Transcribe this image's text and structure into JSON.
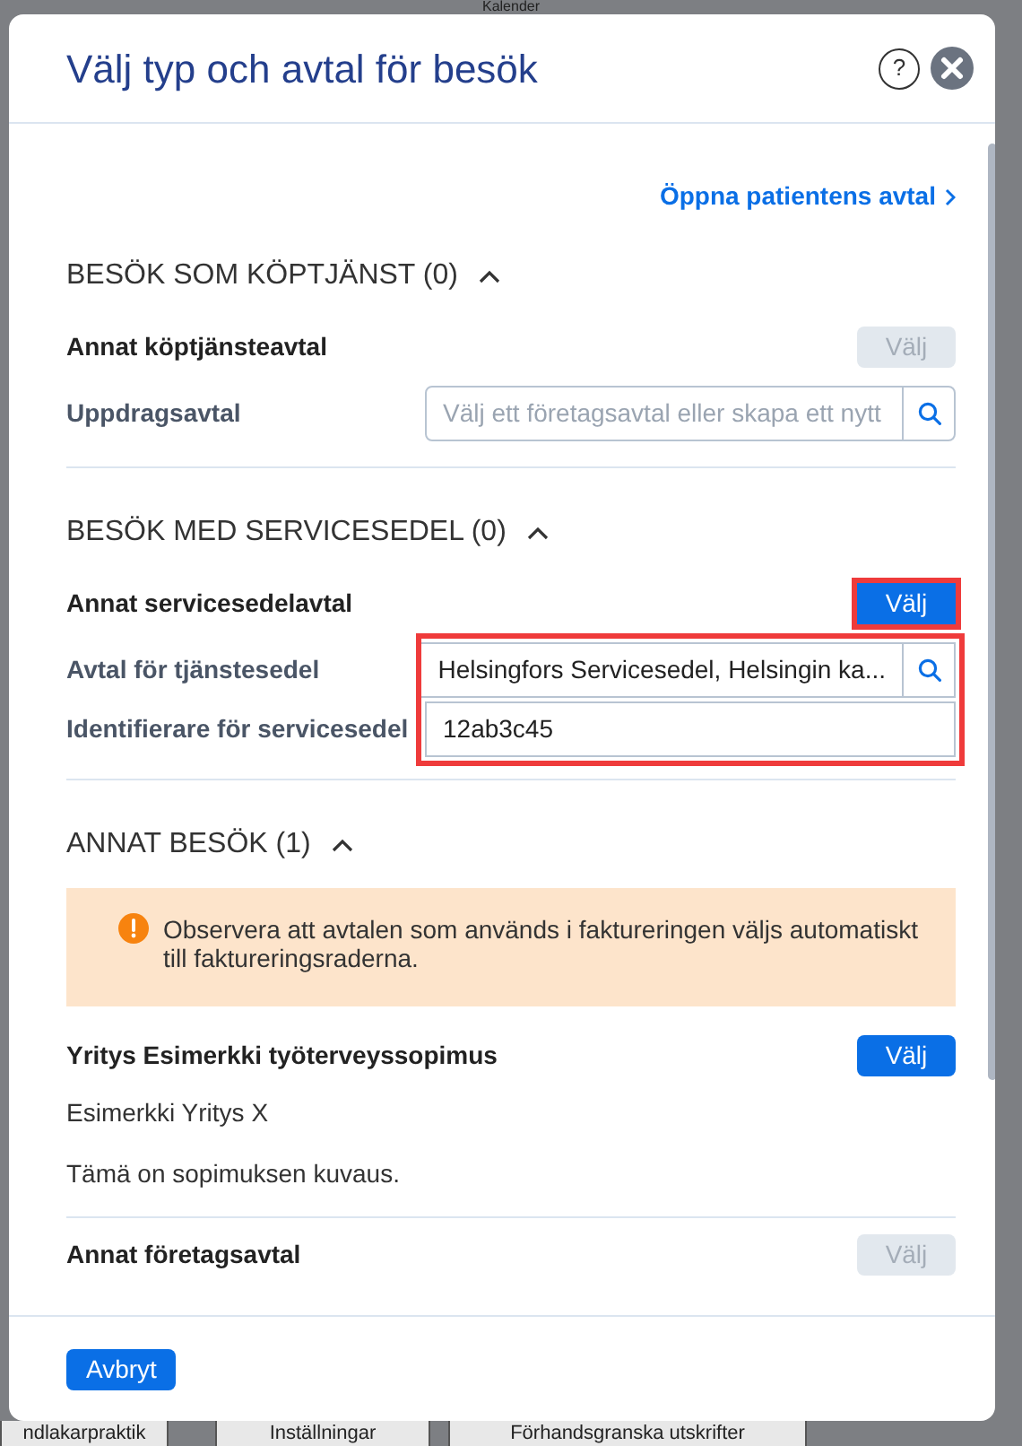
{
  "background": {
    "header_title": "Kalender",
    "bottom_tabs": [
      "ndlakarpraktik",
      "Inställningar",
      "Förhandsgranska utskrifter"
    ]
  },
  "dialog": {
    "title": "Välj typ och avtal för besök",
    "help_label": "?",
    "link": "Öppna patientens avtal",
    "sections": [
      {
        "title": "BESÖK SOM KÖPTJÄNST (0)",
        "expanded": true,
        "items": [
          {
            "kind": "choice",
            "label": "Annat köptjänsteavtal",
            "button": "Välj",
            "disabled": true,
            "highlighted": false
          },
          {
            "kind": "fields",
            "highlighted": false,
            "fields": [
              {
                "label": "Uppdragsavtal",
                "placeholder": "Välj ett företagsavtal eller skapa ett nytt",
                "search": true
              }
            ]
          }
        ]
      },
      {
        "title": "BESÖK MED SERVICESEDEL (0)",
        "expanded": true,
        "items": [
          {
            "kind": "choice",
            "label": "Annat servicesedelavtal",
            "button": "Välj",
            "disabled": false,
            "highlighted": true
          },
          {
            "kind": "fields",
            "highlighted": true,
            "fields": [
              {
                "label": "Avtal för tjänstesedel",
                "value": "Helsingfors Servicesedel, Helsingin ka...",
                "search": true
              },
              {
                "label": "Identifierare för servicesedel",
                "value": "12ab3c45",
                "search": false
              }
            ]
          }
        ]
      },
      {
        "title": "ANNAT BESÖK (1)",
        "expanded": true,
        "items": [
          {
            "kind": "notice",
            "text": "Observera att avtalen som används i faktureringen väljs automatiskt till faktureringsraderna."
          },
          {
            "kind": "choice",
            "label": "Yritys Esimerkki työterveyssopimus",
            "button": "Välj",
            "disabled": false,
            "highlighted": false
          },
          {
            "kind": "text",
            "text": "Esimerkki Yritys X"
          },
          {
            "kind": "text",
            "text": "Tämä on sopimuksen kuvaus."
          },
          {
            "kind": "divider"
          },
          {
            "kind": "choice",
            "label": "Annat företagsavtal",
            "button": "Välj",
            "disabled": true,
            "highlighted": false
          }
        ]
      }
    ],
    "cancel_button": "Avbryt"
  }
}
